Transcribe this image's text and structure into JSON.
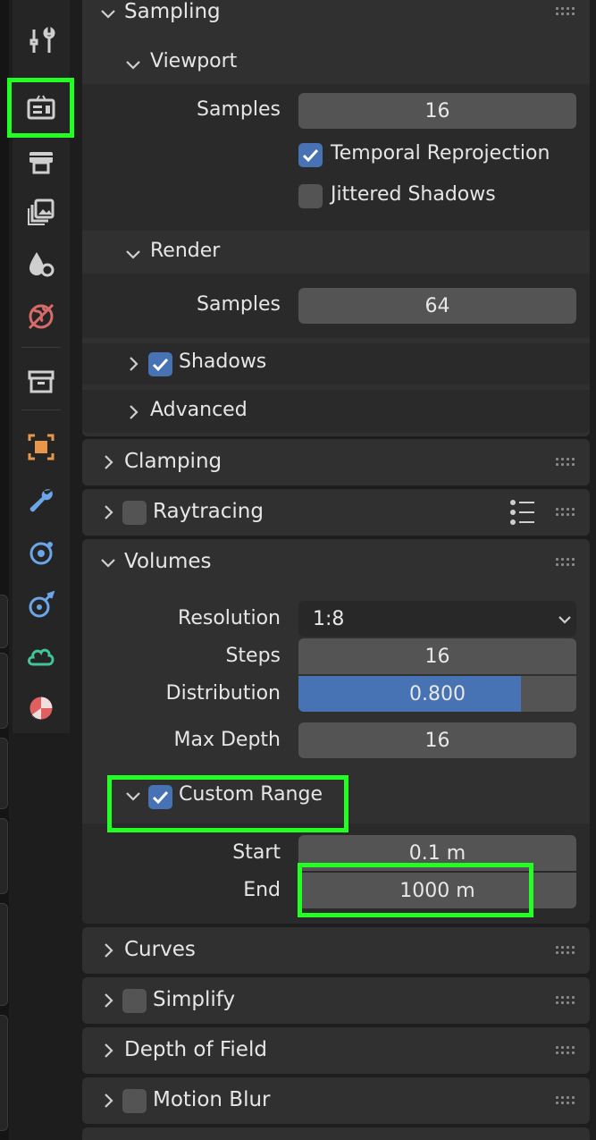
{
  "tabs": [
    {
      "name": "tool-icon",
      "color": "#cfcfcf"
    },
    {
      "name": "render-icon",
      "color": "#cfcfcf"
    },
    {
      "name": "output-icon",
      "color": "#cfcfcf"
    },
    {
      "name": "view-layer-icon",
      "color": "#cfcfcf"
    },
    {
      "name": "scene-icon",
      "color": "#cfcfcf"
    },
    {
      "name": "world-icon",
      "color": "#d96a6a"
    },
    {
      "name": "collection-icon",
      "color": "#cfcfcf"
    },
    {
      "name": "object-icon",
      "color": "#e8964a"
    },
    {
      "name": "modifier-icon",
      "color": "#6aa6e8"
    },
    {
      "name": "physics-icon",
      "color": "#6aa6e8"
    },
    {
      "name": "constraint-icon",
      "color": "#6aa6e8"
    },
    {
      "name": "object-data-icon",
      "color": "#3fc79a"
    },
    {
      "name": "material-icon",
      "color": "#e06060"
    }
  ],
  "sampling": {
    "title": "Sampling",
    "viewport": {
      "title": "Viewport",
      "samples_label": "Samples",
      "samples_value": "16",
      "temporal_reprojection_label": "Temporal Reprojection",
      "temporal_reprojection_checked": true,
      "jittered_shadows_label": "Jittered Shadows",
      "jittered_shadows_checked": false
    },
    "render": {
      "title": "Render",
      "samples_label": "Samples",
      "samples_value": "64"
    },
    "shadows_label": "Shadows",
    "shadows_checked": true,
    "advanced_label": "Advanced"
  },
  "clamping": {
    "title": "Clamping"
  },
  "raytracing": {
    "title": "Raytracing",
    "checked": false
  },
  "volumes": {
    "title": "Volumes",
    "resolution_label": "Resolution",
    "resolution_value": "1:8",
    "steps_label": "Steps",
    "steps_value": "16",
    "distribution_label": "Distribution",
    "distribution_value": "0.800",
    "distribution_fraction": 0.8,
    "max_depth_label": "Max Depth",
    "max_depth_value": "16",
    "custom_range": {
      "label": "Custom Range",
      "checked": true,
      "start_label": "Start",
      "start_value": "0.1 m",
      "end_label": "End",
      "end_value": "1000 m"
    }
  },
  "curves": {
    "title": "Curves"
  },
  "simplify": {
    "title": "Simplify",
    "checked": false
  },
  "depth_of_field": {
    "title": "Depth of Field"
  },
  "motion_blur": {
    "title": "Motion Blur",
    "checked": false
  },
  "colors": {
    "highlight": "#22ff22",
    "accent": "#4772b3",
    "panel_bg": "#303030",
    "field_bg": "#545454"
  }
}
